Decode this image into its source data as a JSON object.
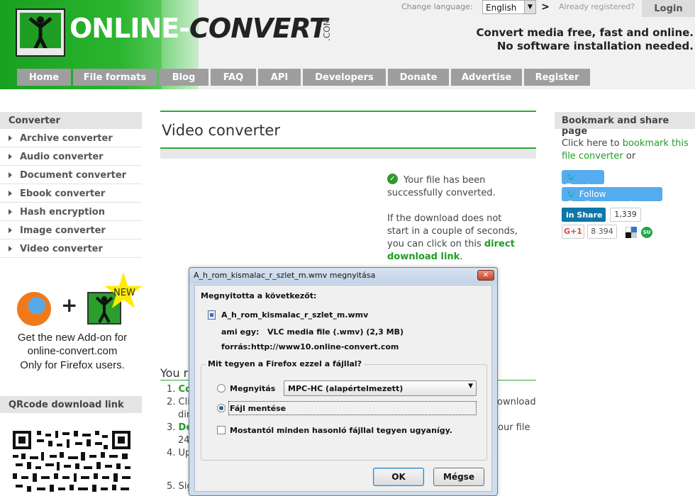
{
  "header": {
    "logo_left": "ONLINE-",
    "logo_right": "CONVERT",
    "logo_suffix": ".COM",
    "change_language_label": "Change language:",
    "language_value": "English",
    "language_go": ">",
    "registered_label": "Already registered?",
    "login_label": "Login",
    "tagline_1": "Convert media free, fast and online.",
    "tagline_2": "No software installation needed."
  },
  "nav": [
    {
      "label": "Home"
    },
    {
      "label": "File formats"
    },
    {
      "label": "Blog"
    },
    {
      "label": "FAQ"
    },
    {
      "label": "API"
    },
    {
      "label": "Developers"
    },
    {
      "label": "Donate"
    },
    {
      "label": "Advertise"
    },
    {
      "label": "Register"
    }
  ],
  "left": {
    "converter_heading": "Converter",
    "converters": [
      {
        "label": "Archive converter"
      },
      {
        "label": "Audio converter"
      },
      {
        "label": "Document converter"
      },
      {
        "label": "Ebook converter"
      },
      {
        "label": "Hash encryption"
      },
      {
        "label": "Image converter"
      },
      {
        "label": "Video converter"
      }
    ],
    "addon_plus": "+",
    "addon_new": "NEW",
    "addon_line_1": "Get the new Add-on for",
    "addon_line_2": "online-convert.com",
    "addon_line_3": "Only for Firefox users.",
    "qr_heading": "QRcode download link"
  },
  "main": {
    "title": "Video converter",
    "success_line_1": "Your file has been",
    "success_line_2": "successfully converted.",
    "download_line_1": "If the download does not",
    "download_line_2": "start in a couple of seconds,",
    "download_line_3": "you can click on this",
    "download_link_a": "direct",
    "download_link_b": "download link",
    "download_period": ".",
    "you_heading": "You r",
    "steps": [
      {
        "num": "1.",
        "text": "Co"
      },
      {
        "num": "2.",
        "text": "Cli"
      },
      {
        "num": "",
        "text": "dir"
      },
      {
        "num": "3.",
        "text": "De"
      },
      {
        "num": "",
        "text": "24"
      },
      {
        "num": "4.",
        "text": "Up"
      },
      {
        "num": "5.",
        "text": "Sig"
      }
    ],
    "step_right_1": "ownload",
    "step_right_2": "our file"
  },
  "right": {
    "heading": "Bookmark and share page",
    "bm_prefix": "Click here to ",
    "bm_link": "bookmark this file converter",
    "bm_suffix": " or",
    "tweet_label": "🐦 Tweet",
    "follow_label": "🐦 Follow @onlineconvert",
    "linkedin_label": "in  Share",
    "linkedin_count": "1,339",
    "gplus_label": "G+1",
    "gplus_count": "8 394",
    "su_label": "SU"
  },
  "dialog": {
    "title": "A_h_rom_kismalac_r_szlet_m.wmv megnyitása",
    "close_label": "✕",
    "opened_label": "Megnyitotta a következőt:",
    "filename": "A_h_rom_kismalac_r_szlet_m.wmv",
    "type_label": "ami egy:",
    "type_value": "VLC media file (.wmv) (2,3 MB)",
    "from_label": "forrás:",
    "from_value": "http://www10.online-convert.com",
    "question": "Mit tegyen a Firefox ezzel a fájllal?",
    "open_with_label": "Megnyitás",
    "app_value": "MPC-HC (alapértelmezett)",
    "save_label": "Fájl mentése",
    "remember_label": "Mostantól minden hasonló fájllal tegyen ugyanígy.",
    "ok_label": "OK",
    "cancel_label": "Mégse"
  },
  "colors": {
    "brand_green": "#1f9d24",
    "nav_gray": "#9e9e9e",
    "twitter_blue": "#55acee",
    "linkedin_blue": "#0e76a8"
  }
}
